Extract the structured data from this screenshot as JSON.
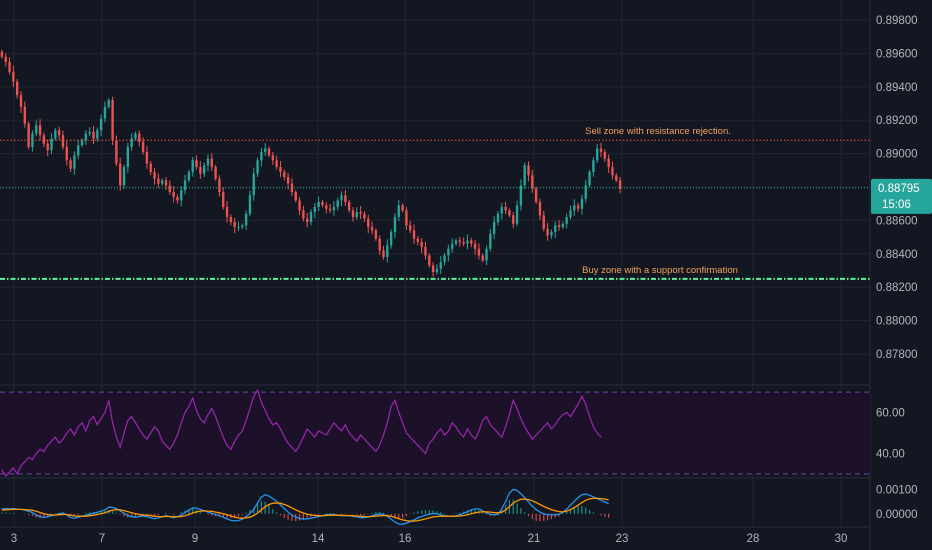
{
  "colors": {
    "background": "#131722",
    "grid": "#1f2430",
    "axis_text": "#b2b5be",
    "candle_up": "#26a69a",
    "candle_down": "#ef5350",
    "resistance_line": "#f2543d",
    "support_line": "#5df2a0",
    "price_line": "#26a69a",
    "annotation_text": "#f5a05a",
    "rsi_line": "#9c27b0",
    "rsi_band_fill": "#1c1128",
    "rsi_band_line": "#7e57c2",
    "macd_line": "#2196f3",
    "signal_line": "#ff9800",
    "hist_up": "#26a69a",
    "hist_down": "#ef5350"
  },
  "chart_data": [
    {
      "type": "candlestick",
      "name": "price",
      "x_ticks": [
        "3",
        "7",
        "9",
        "14",
        "16",
        "21",
        "23",
        "28",
        "30"
      ],
      "y_ticks": [
        "0.87800",
        "0.88000",
        "0.88200",
        "0.88400",
        "0.88600",
        "0.88800",
        "0.89000",
        "0.89200",
        "0.89400",
        "0.89600",
        "0.89800"
      ],
      "ylim": [
        0.8762,
        0.8992
      ],
      "grid": true,
      "close_values": [
        0.8958,
        0.8955,
        0.8949,
        0.8943,
        0.8935,
        0.8928,
        0.8918,
        0.8904,
        0.8912,
        0.8917,
        0.8911,
        0.8906,
        0.8902,
        0.8909,
        0.8914,
        0.8911,
        0.8904,
        0.8896,
        0.8891,
        0.8899,
        0.8905,
        0.8908,
        0.8912,
        0.8913,
        0.8909,
        0.8914,
        0.8921,
        0.8928,
        0.8932,
        0.8908,
        0.8894,
        0.8881,
        0.8892,
        0.8904,
        0.8909,
        0.8912,
        0.8907,
        0.8901,
        0.8894,
        0.8889,
        0.8885,
        0.8882,
        0.8884,
        0.8881,
        0.8877,
        0.8874,
        0.8872,
        0.8878,
        0.8884,
        0.8889,
        0.8896,
        0.8892,
        0.8888,
        0.8893,
        0.8897,
        0.8892,
        0.8885,
        0.8877,
        0.8868,
        0.8862,
        0.8859,
        0.8856,
        0.8856,
        0.8857,
        0.8864,
        0.8875,
        0.8888,
        0.8896,
        0.8901,
        0.8903,
        0.8899,
        0.8896,
        0.8892,
        0.8889,
        0.8886,
        0.8882,
        0.8877,
        0.8872,
        0.8866,
        0.8861,
        0.8859,
        0.8865,
        0.8868,
        0.8871,
        0.8869,
        0.8867,
        0.8866,
        0.8868,
        0.8872,
        0.8875,
        0.8871,
        0.8866,
        0.8862,
        0.8865,
        0.8864,
        0.8861,
        0.8856,
        0.8854,
        0.8849,
        0.8842,
        0.8838,
        0.8845,
        0.8853,
        0.8862,
        0.8869,
        0.8866,
        0.8857,
        0.8854,
        0.8849,
        0.8847,
        0.8844,
        0.8839,
        0.8833,
        0.8829,
        0.8831,
        0.8835,
        0.8839,
        0.8843,
        0.8846,
        0.8848,
        0.8847,
        0.8846,
        0.8848,
        0.8846,
        0.8843,
        0.8839,
        0.8836,
        0.8843,
        0.8852,
        0.8859,
        0.8864,
        0.8868,
        0.8866,
        0.8863,
        0.8858,
        0.8869,
        0.8881,
        0.8893,
        0.8887,
        0.8879,
        0.8871,
        0.8863,
        0.8855,
        0.8851,
        0.8853,
        0.8857,
        0.8856,
        0.8858,
        0.8862,
        0.8866,
        0.8869,
        0.8867,
        0.8873,
        0.8881,
        0.8889,
        0.8896,
        0.8903,
        0.8901,
        0.8897,
        0.8892,
        0.8887,
        0.8884,
        0.8879
      ]
    },
    {
      "type": "line",
      "name": "rsi",
      "y_ticks": [
        "40.00",
        "60.00"
      ],
      "ylim": [
        28,
        72
      ],
      "band": [
        30,
        70
      ],
      "values": [
        32,
        29,
        31,
        33,
        30,
        34,
        36,
        38,
        37,
        40,
        42,
        41,
        44,
        46,
        48,
        45,
        47,
        50,
        52,
        49,
        53,
        55,
        51,
        56,
        58,
        54,
        57,
        60,
        66,
        55,
        48,
        43,
        50,
        56,
        58,
        55,
        52,
        49,
        47,
        50,
        53,
        51,
        46,
        44,
        42,
        45,
        49,
        55,
        60,
        63,
        67,
        61,
        57,
        55,
        59,
        62,
        58,
        53,
        48,
        44,
        42,
        46,
        49,
        51,
        56,
        62,
        68,
        71,
        65,
        61,
        57,
        54,
        55,
        52,
        48,
        45,
        43,
        41,
        44,
        48,
        52,
        50,
        48,
        51,
        50,
        49,
        52,
        55,
        53,
        51,
        54,
        50,
        48,
        46,
        49,
        47,
        45,
        43,
        41,
        44,
        49,
        55,
        63,
        66,
        60,
        55,
        50,
        48,
        46,
        44,
        42,
        40,
        45,
        47,
        50,
        52,
        49,
        51,
        55,
        53,
        50,
        48,
        52,
        49,
        47,
        51,
        56,
        58,
        54,
        52,
        50,
        48,
        53,
        59,
        66,
        62,
        57,
        53,
        50,
        47,
        49,
        51,
        53,
        55,
        52,
        54,
        57,
        59,
        60,
        58,
        61,
        64,
        68,
        64,
        58,
        53,
        50,
        48
      ]
    },
    {
      "type": "line",
      "name": "macd",
      "y_ticks": [
        "0.00000",
        "0.00100"
      ],
      "ylim": [
        -0.0005,
        0.00138
      ],
      "series": [
        {
          "values": [
            0.0002,
            0.00021,
            0.0002,
            0.00021,
            0.00019,
            0.00018,
            0.00015,
            0.0001,
            5e-05,
            -5e-05,
            -0.00012,
            -0.00015,
            -0.00012,
            -8e-05,
            -4e-05,
            0.0,
            3e-05,
            -5e-05,
            -0.00015,
            -0.00018,
            -0.00014,
            -0.0001,
            -6e-05,
            -2e-05,
            2e-05,
            6e-05,
            0.00011,
            0.00016,
            0.00027,
            0.00026,
            0.00021,
            0.00012,
            2e-05,
            -7e-05,
            -0.00012,
            -0.00014,
            -0.00011,
            -9e-05,
            -0.00012,
            -0.00016,
            -0.0002,
            -0.00017,
            -0.00012,
            -7e-05,
            -0.00012,
            -0.00016,
            -0.00012,
            -5e-05,
            5e-05,
            0.00015,
            0.00024,
            0.00023,
            0.00018,
            0.00012,
            7e-05,
            2e-05,
            -3e-05,
            -8e-05,
            -0.00014,
            -0.00021,
            -0.00027,
            -0.00029,
            -0.00028,
            -0.00022,
            -0.00012,
            1e-05,
            0.00018,
            0.00045,
            0.00068,
            0.00078,
            0.00072,
            0.00062,
            0.0005,
            0.00036,
            0.00021,
            7e-05,
            -5e-05,
            -0.00014,
            -0.00019,
            -0.00022,
            -0.00021,
            -0.00018,
            -0.00015,
            -0.00011,
            -8e-05,
            -4e-05,
            -3e-05,
            -3e-05,
            -6e-05,
            -8e-05,
            -8e-05,
            -8e-05,
            -0.0001,
            -0.00013,
            -0.00016,
            -0.00016,
            -0.00013,
            -8e-05,
            -3e-05,
            0.0,
            -3e-05,
            -0.0001,
            -0.00022,
            -0.00034,
            -0.00042,
            -0.00043,
            -0.00038,
            -0.00032,
            -0.00025,
            -0.00017,
            -0.00011,
            -6e-05,
            -2e-05,
            1e-05,
            0.0,
            -4e-05,
            -8e-05,
            -0.0001,
            -0.00011,
            -8e-05,
            -4e-05,
            2e-05,
            9e-05,
            0.00016,
            0.0002,
            0.0002,
            0.00012,
            4e-05,
            -2e-05,
            -4e-05,
            -2e-05,
            0.0002,
            0.0005,
            0.00085,
            0.001,
            0.00095,
            0.00082,
            0.00066,
            0.00048,
            0.00031,
            0.00017,
            7e-05,
            0.0,
            -4e-05,
            -5e-05,
            -4e-05,
            -2e-05,
            6e-05,
            0.00019,
            0.00035,
            0.00051,
            0.00066,
            0.00078,
            0.00081,
            0.00076,
            0.00069,
            0.00062,
            0.00055,
            0.00048,
            0.00041
          ]
        },
        {
          "values": [
            0.00015,
            0.00016,
            0.00017,
            0.00018,
            0.00018,
            0.00018,
            0.00017,
            0.00016,
            0.00014,
            0.0001,
            5e-05,
            0.0,
            -3e-05,
            -5e-05,
            -5e-05,
            -4e-05,
            -3e-05,
            -3e-05,
            -6e-05,
            -9e-05,
            -0.0001,
            -0.0001,
            -0.0001,
            -8e-05,
            -6e-05,
            -3e-05,
            0.0,
            4e-05,
            0.0001,
            0.00015,
            0.00017,
            0.00016,
            0.00013,
            9e-05,
            4e-05,
            0.0,
            -3e-05,
            -5e-05,
            -6e-05,
            -8e-05,
            -0.0001,
            -0.00011,
            -0.00012,
            -0.00011,
            -0.00011,
            -0.00012,
            -0.00012,
            -0.00011,
            -8e-05,
            -3e-05,
            3e-05,
            8e-05,
            0.00011,
            0.00012,
            0.00011,
            0.0001,
            7e-05,
            4e-05,
            0.0,
            -4e-05,
            -9e-05,
            -0.00014,
            -0.00017,
            -0.00018,
            -0.00017,
            -0.00014,
            -7e-05,
            3e-05,
            0.00016,
            0.00029,
            0.00038,
            0.00043,
            0.00044,
            0.00043,
            0.00038,
            0.00032,
            0.00024,
            0.00016,
            9e-05,
            3e-05,
            -2e-05,
            -5e-05,
            -7e-05,
            -8e-05,
            -8e-05,
            -7e-05,
            -6e-05,
            -6e-05,
            -6e-05,
            -6e-05,
            -7e-05,
            -7e-05,
            -8e-05,
            -9e-05,
            -0.0001,
            -0.00011,
            -0.00012,
            -0.00011,
            -0.0001,
            -8e-05,
            -7e-05,
            -8e-05,
            -0.0001,
            -0.00015,
            -0.0002,
            -0.00025,
            -0.00028,
            -0.0003,
            -0.0003,
            -0.00028,
            -0.00025,
            -0.00021,
            -0.00017,
            -0.00013,
            -0.00011,
            -0.0001,
            -0.0001,
            -0.0001,
            -0.0001,
            -0.0001,
            -9e-05,
            -7e-05,
            -4e-05,
            0.0,
            4e-05,
            7e-05,
            8e-05,
            8e-05,
            7e-05,
            5e-05,
            4e-05,
            7e-05,
            0.00015,
            0.00029,
            0.00043,
            0.00053,
            0.00059,
            0.0006,
            0.00058,
            0.00053,
            0.00046,
            0.00038,
            0.0003,
            0.00023,
            0.00017,
            0.00012,
            9e-05,
            8e-05,
            0.00011,
            0.00017,
            0.00025,
            0.00035,
            0.00046,
            0.00055,
            0.00061,
            0.00063,
            0.00063,
            0.00062,
            0.0006,
            0.00057
          ]
        }
      ]
    }
  ],
  "price_axis": {
    "current_price": "0.88795",
    "countdown": "15:06"
  },
  "annotations": {
    "resistance": {
      "label": "Sell zone with resistance rejection.",
      "price": 0.8908
    },
    "support": {
      "label": "Buy zone with a support confirmation",
      "price": 0.8825
    }
  }
}
